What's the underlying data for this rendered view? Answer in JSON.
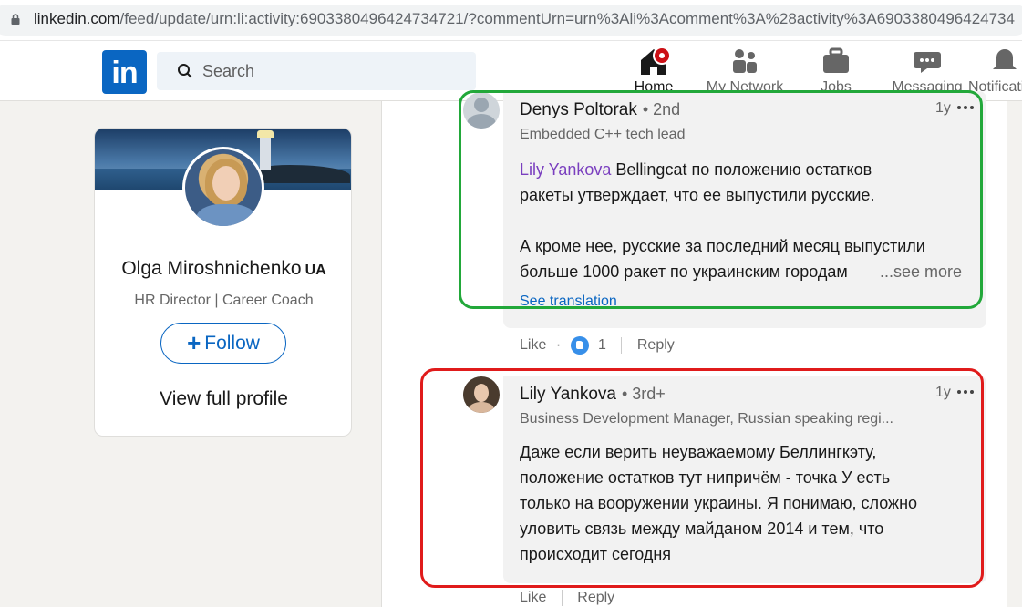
{
  "browser": {
    "url_host": "linkedin.com",
    "url_path": "/feed/update/urn:li:activity:6903380496424734721/?commentUrn=urn%3Ali%3Acomment%3A%28activity%3A6903380496424734"
  },
  "header": {
    "logo_text": "in",
    "search_placeholder": "Search",
    "nav": {
      "home": "Home",
      "network": "My Network",
      "jobs": "Jobs",
      "messaging": "Messaging",
      "notifications": "Notifications"
    },
    "icons": [
      "home-icon",
      "network-icon",
      "jobs-icon",
      "messaging-icon",
      "notifications-icon",
      "search-icon",
      "lock-icon"
    ]
  },
  "profile": {
    "name": "Olga Miroshnichenko",
    "flag": "UA",
    "title": "HR Director | Career Coach",
    "follow_label": "Follow",
    "view_profile_label": "View full profile"
  },
  "comments": [
    {
      "author": "Denys Poltorak",
      "degree": "• 2nd",
      "headline": "Embedded C++ tech lead",
      "time": "1y",
      "mention": "Lily Yankova",
      "line1": " Bellingcat по положению остатков",
      "line2": "ракеты утверждает, что ее выпустили русские.",
      "line3": "А кроме нее, русские за последний месяц выпустили",
      "line4": "больше 1000 ракет по украинским городам",
      "see_more": "...see more",
      "see_translation": "See translation",
      "actions": {
        "like": "Like",
        "reaction_count": "1",
        "reply": "Reply"
      }
    },
    {
      "author": "Lily Yankova",
      "degree": "• 3rd+",
      "headline": "Business Development Manager, Russian speaking regi...",
      "time": "1y",
      "lines": [
        "Даже если верить неуважаемому Беллингкэту,",
        "положение остатков тут нипричём - точка У есть",
        "только на вооружении украины. Я понимаю, сложно",
        "уловить связь между майданом 2014 и тем, что",
        "происходит сегодня"
      ],
      "actions": {
        "like": "Like",
        "reply": "Reply"
      }
    }
  ],
  "colors": {
    "brand": "#0a66c2",
    "notification_badge": "#cc1016",
    "highlight_green": "#22a83a",
    "highlight_red": "#e01b1b"
  }
}
